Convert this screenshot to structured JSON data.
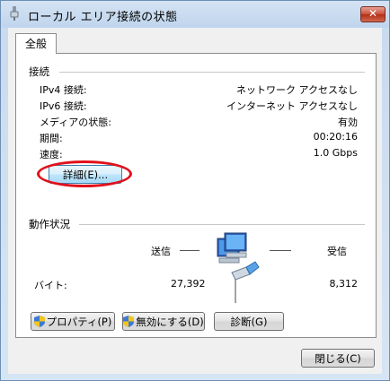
{
  "window": {
    "title": "ローカル エリア接続の状態",
    "close_label": "✕"
  },
  "tab": {
    "label": "全般"
  },
  "connection": {
    "heading": "接続",
    "rows": [
      {
        "label": "IPv4 接続:",
        "value": "ネットワーク アクセスなし"
      },
      {
        "label": "IPv6 接続:",
        "value": "インターネット アクセスなし"
      },
      {
        "label": "メディアの状態:",
        "value": "有効"
      },
      {
        "label": "期間:",
        "value": "00:20:16"
      },
      {
        "label": "速度:",
        "value": "1.0 Gbps"
      }
    ],
    "details_button": "詳細(E)..."
  },
  "activity": {
    "heading": "動作状況",
    "sent_label": "送信",
    "received_label": "受信",
    "bytes_label": "バイト:",
    "bytes_sent": "27,392",
    "bytes_received": "8,312",
    "icon": "network-computers-icon"
  },
  "buttons": {
    "properties": "プロパティ(P)",
    "disable": "無効にする(D)",
    "diagnose": "診断(G)",
    "close": "閉じる(C)"
  },
  "colors": {
    "highlight_circle": "#e0101a",
    "titlebar": "#c0d6ee"
  }
}
